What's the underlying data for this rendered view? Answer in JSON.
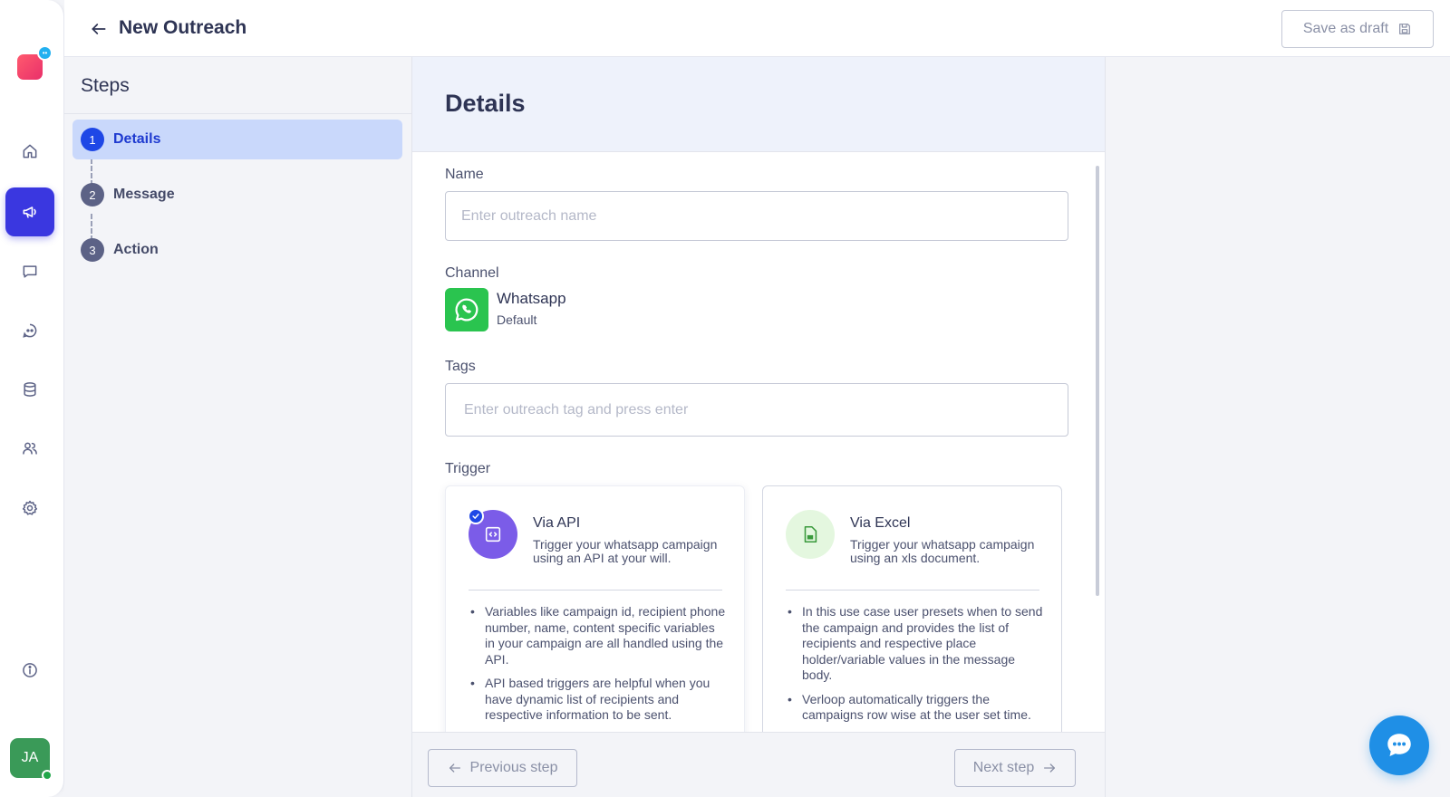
{
  "header": {
    "title": "New Outreach",
    "save_draft_label": "Save as draft"
  },
  "rail": {
    "icons": [
      "home-icon",
      "megaphone-icon",
      "chat-icon",
      "bot-icon",
      "database-icon",
      "users-icon",
      "settings-icon",
      "info-icon"
    ],
    "active": "megaphone-icon",
    "avatar_initials": "JA",
    "accent_color": "#3a37e0"
  },
  "steps": {
    "title": "Steps",
    "items": [
      {
        "number": "1",
        "label": "Details",
        "active": true
      },
      {
        "number": "2",
        "label": "Message",
        "active": false
      },
      {
        "number": "3",
        "label": "Action",
        "active": false
      }
    ]
  },
  "details": {
    "title": "Details",
    "name_label": "Name",
    "name_placeholder": "Enter outreach name",
    "name_value": "",
    "channel_label": "Channel",
    "channel_name": "Whatsapp",
    "channel_sub": "Default",
    "tags_label": "Tags",
    "tags_placeholder": "Enter outreach tag and press enter",
    "tags_value": "",
    "trigger_label": "Trigger",
    "triggers": [
      {
        "title": "Via API",
        "description": "Trigger your whatsapp campaign using an API at your will.",
        "selected": true,
        "bullets": [
          "Variables like campaign id, recipient phone number, name, content specific variables in your campaign are all handled using the API.",
          "API based triggers are helpful when you have dynamic list of recipients and respective information to be sent."
        ]
      },
      {
        "title": "Via Excel",
        "description": "Trigger your whatsapp campaign using an xls document.",
        "selected": false,
        "bullets": [
          "In this use case user presets when to send the campaign and provides the list of recipients and respective place holder/variable values in the message body.",
          "Verloop automatically triggers the campaigns row wise at the user set time."
        ]
      }
    ]
  },
  "footer": {
    "prev_label": "Previous step",
    "next_label": "Next step"
  },
  "colors": {
    "step_active_bg": "#c9d8fb",
    "step_active_num": "#1e47e6",
    "whatsapp_green": "#2ac44f",
    "api_icon_bg": "#7b5ce8",
    "excel_icon_bg": "#e4f7df",
    "chat_fab": "#1f8fe6"
  }
}
